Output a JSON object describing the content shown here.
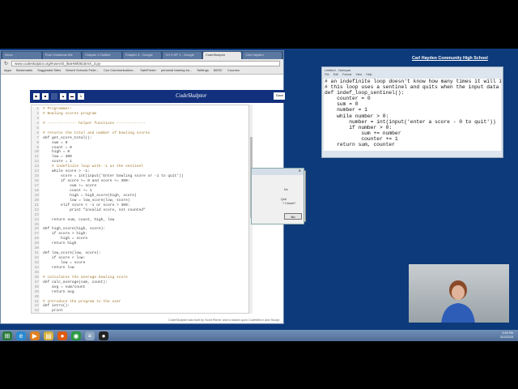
{
  "browser": {
    "tabs": [
      "Inbox",
      "Post Christmas Wk",
      "Chapter 4 Outline",
      "Chapter 4 - Google",
      "CH 4 HP 1 - Google",
      "CodeSkulptor",
      "Carl Hayden"
    ],
    "active_tab": 5,
    "url": "www.codeskulptor.org/#user40_l9aHWl0615mX_3.py",
    "bookmarks": [
      "Apps",
      "Bookmarks",
      "Suggested Sites",
      "Desert Schools Fede...",
      "Cox Communication...",
      "SafeFinder",
      "personal training bo...",
      "Settings",
      "BDSC",
      "Courses"
    ]
  },
  "codeskulptor": {
    "title": "CodeSkulptor",
    "toolbar_buttons": [
      "run",
      "save",
      "fresh-url",
      "open-local",
      "reset",
      "viz"
    ],
    "docs_label": "Docs",
    "footer": "CodeSkulptor was built by Scott Rixner and is based upon CodeMirror and Skulpt.",
    "code": [
      "# Programmer:",
      "# Bowling scores program",
      "",
      "# ------------- helper functions -------------",
      "",
      "# returns the total and number of bowling scores",
      "def get_score_total():",
      "    sum = 0",
      "    count = 0",
      "    high = 0",
      "    low = 300",
      "    score = 1",
      "    # indefinite loop with -1 as the sentinel",
      "    while score > -1:",
      "        score = int(input('Enter bowling score or -1 to quit'))",
      "        if score >= 0 and score <= 300:",
      "            sum += score",
      "            count += 1",
      "            high = high_score(high, score)",
      "            low = low_score(low, score)",
      "        elif score < -1 or score > 300:",
      "            print \"invalid score, not counted\"",
      "",
      "    return sum, count, high, low",
      "",
      "def high_score(high, score):",
      "    if score > high:",
      "        high = score",
      "    return high",
      "",
      "def low_score(low, score):",
      "    if score < low:",
      "        low = score",
      "    return low",
      "",
      "# calculates the average bowling score",
      "def calc_average(sum, count):",
      "    avg = sum/count",
      "    return avg",
      "",
      "# introduce the program to the user",
      "def intro():",
      "    print"
    ]
  },
  "dialog": {
    "text1": "No",
    "text2": "Quit",
    "text3": "? Cancel?",
    "button": "No"
  },
  "school_label": "Carl Hayden Community High School",
  "notepad": {
    "title": "Untitled - Notepad",
    "menu": [
      "File",
      "Edit",
      "Format",
      "View",
      "Help"
    ],
    "text": "# an indefinite loop doesn't know how many times it will it\n# this loop uses a sentinel and quits when the input data i\ndef indef_loop_sentinel():\n    counter = 0\n    sum = 0\n    number = 1\n    while number > 0:\n        number = int(input('enter a score - 0 to quit'))\n        if number > 0:\n            sum += number\n            counter += 1\n    return sum, counter"
  },
  "taskbar": {
    "icons": [
      "start",
      "ie",
      "media-player",
      "explorer",
      "firefox",
      "chrome",
      "notepad",
      "obs"
    ],
    "time": "5:53 PM",
    "date": "3/12/2015"
  }
}
